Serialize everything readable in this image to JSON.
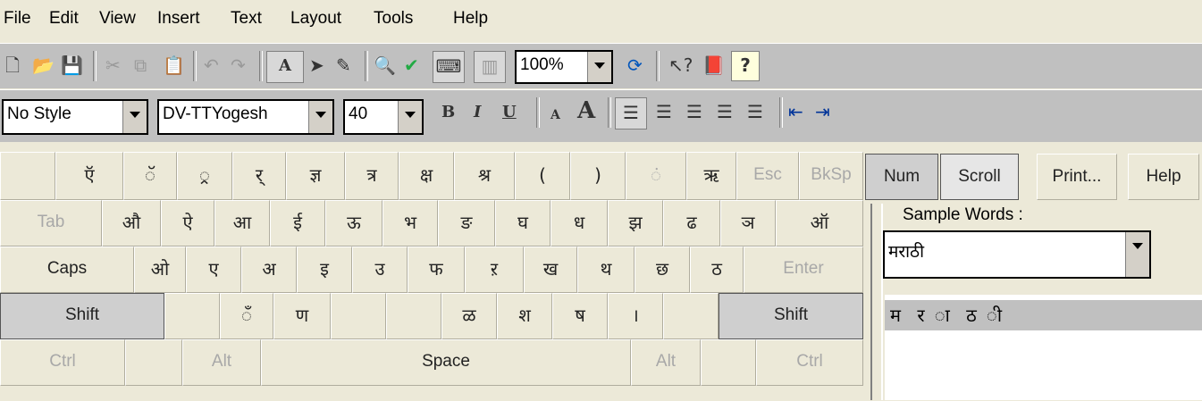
{
  "menu": [
    "File",
    "Edit",
    "View",
    "Insert",
    "Text",
    "Layout",
    "Tools",
    "Help"
  ],
  "toolbar1": {
    "icons": [
      "new-icon",
      "open-icon",
      "save-icon",
      "cut-icon",
      "copy-icon",
      "paste-icon",
      "undo-icon",
      "redo-icon",
      "font-style-icon",
      "pointer-icon",
      "pencil-icon",
      "find-icon",
      "spellcheck-icon",
      "keyboard-icon",
      "columns-icon",
      "refresh-icon",
      "help-pointer-icon",
      "book-icon",
      "help-icon"
    ],
    "zoom": "100%"
  },
  "toolbar2": {
    "style": "No Style",
    "font": "DV-TTYogesh",
    "size": "40",
    "bold": "B",
    "italic": "I",
    "underline": "U",
    "font_small": "A",
    "font_large": "A"
  },
  "keyboard": {
    "row1": [
      "",
      "ऍ",
      "ॅ",
      "्र",
      "र्",
      "ज्ञ",
      "त्र",
      "क्ष",
      "श्र",
      "(",
      ")",
      "ं",
      "ऋ",
      "Esc",
      "BkSp"
    ],
    "row2": [
      "Tab",
      "औ",
      "ऐ",
      "आ",
      "ई",
      "ऊ",
      "भ",
      "ङ",
      "घ",
      "ध",
      "झ",
      "ढ",
      "ञ",
      "ऑ"
    ],
    "row3": [
      "Caps",
      "ओ",
      "ए",
      "अ",
      "इ",
      "उ",
      "फ",
      "ऱ",
      "ख",
      "थ",
      "छ",
      "ठ",
      "Enter"
    ],
    "row4": [
      "Shift",
      "",
      "ँ",
      "ण",
      "",
      "",
      "ळ",
      "श",
      "ष",
      "।",
      "",
      "Shift"
    ],
    "row5": [
      "Ctrl",
      "",
      "Alt",
      "Space",
      "Alt",
      "",
      "Ctrl"
    ]
  },
  "side_buttons": [
    "Num",
    "Scroll",
    "Print...",
    "Help"
  ],
  "sample": {
    "label": "Sample Words :",
    "value": "मराठी",
    "letters": "म र ा ठ ी"
  }
}
